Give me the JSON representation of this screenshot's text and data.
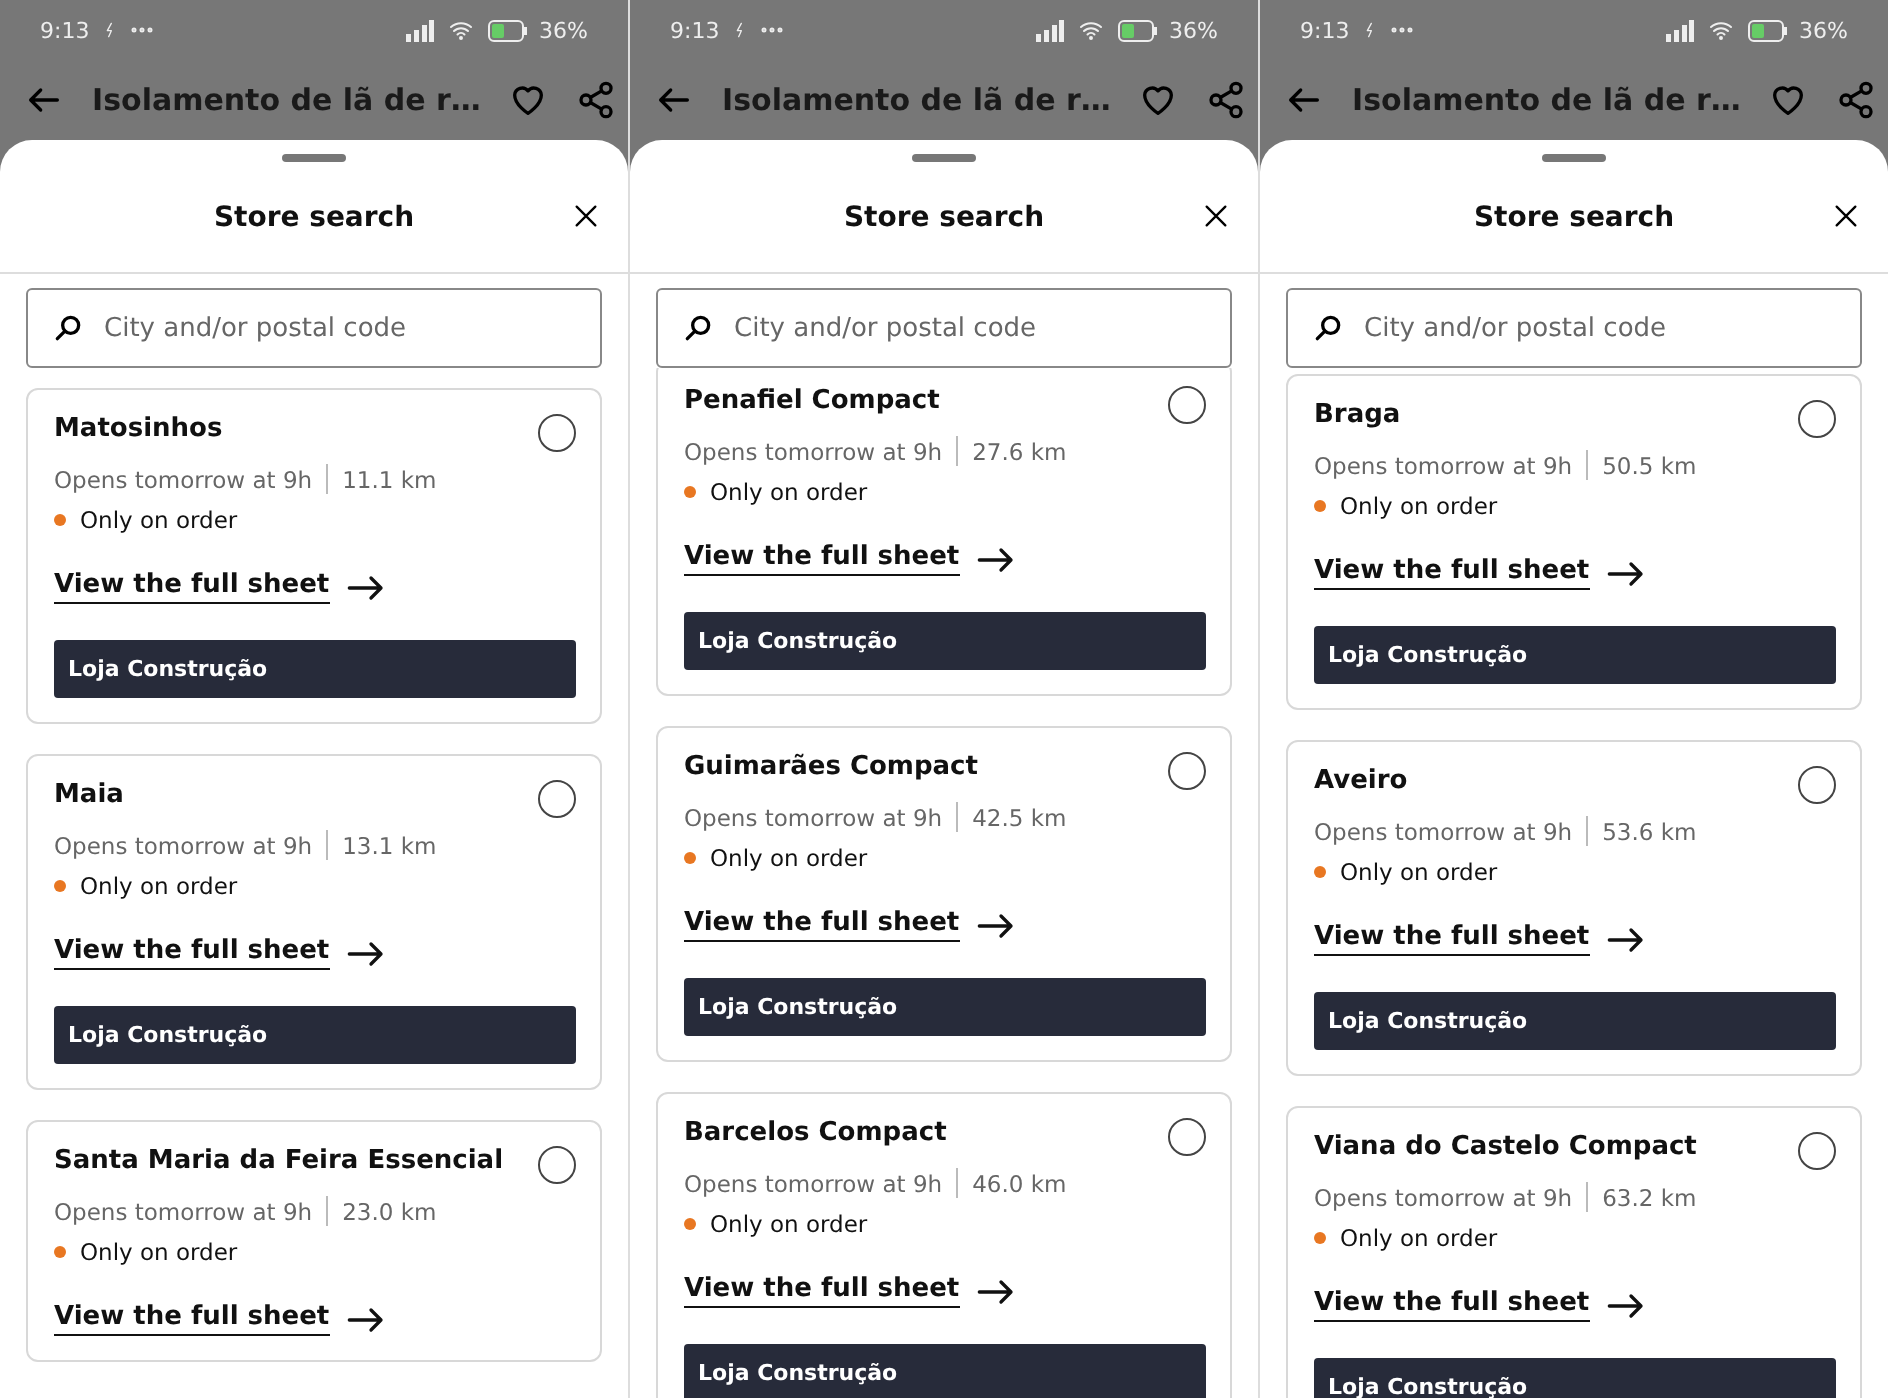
{
  "screens": [
    {
      "status": {
        "time": "9:13",
        "battery": "36%"
      },
      "header": {
        "title": "Isolamento de lã de r…"
      },
      "sheet": {
        "title": "Store search",
        "search": {
          "placeholder": "City and/or postal code"
        }
      },
      "stores": [
        {
          "name": "Matosinhos",
          "opens": "Opens tomorrow at 9h",
          "distance": "11.1 km",
          "availability": "Only on order",
          "link": "View the full sheet",
          "button": "Loja Construção",
          "selected": false
        },
        {
          "name": "Maia",
          "opens": "Opens tomorrow at 9h",
          "distance": "13.1 km",
          "availability": "Only on order",
          "link": "View the full sheet",
          "button": "Loja Construção",
          "selected": false
        },
        {
          "name": "Santa Maria da Feira Essencial",
          "opens": "Opens tomorrow at 9h",
          "distance": "23.0 km",
          "availability": "Only on order",
          "link": "View the full sheet",
          "selected": false
        }
      ]
    },
    {
      "status": {
        "time": "9:13",
        "battery": "36%"
      },
      "header": {
        "title": "Isolamento de lã de r…"
      },
      "sheet": {
        "title": "Store search",
        "search": {
          "placeholder": "City and/or postal code"
        }
      },
      "stores": [
        {
          "name": "Penafiel Compact",
          "opens": "Opens tomorrow at 9h",
          "distance": "27.6 km",
          "availability": "Only on order",
          "link": "View the full sheet",
          "button": "Loja Construção",
          "selected": false
        },
        {
          "name": "Guimarães Compact",
          "opens": "Opens tomorrow at 9h",
          "distance": "42.5 km",
          "availability": "Only on order",
          "link": "View the full sheet",
          "button": "Loja Construção",
          "selected": false
        },
        {
          "name": "Barcelos Compact",
          "opens": "Opens tomorrow at 9h",
          "distance": "46.0 km",
          "availability": "Only on order",
          "link": "View the full sheet",
          "button": "Loja Construção",
          "selected": false
        }
      ]
    },
    {
      "status": {
        "time": "9:13",
        "battery": "36%"
      },
      "header": {
        "title": "Isolamento de lã de r…"
      },
      "sheet": {
        "title": "Store search",
        "search": {
          "placeholder": "City and/or postal code"
        }
      },
      "stores": [
        {
          "name": "Braga",
          "opens": "Opens tomorrow at 9h",
          "distance": "50.5 km",
          "availability": "Only on order",
          "link": "View the full sheet",
          "button": "Loja Construção",
          "selected": false
        },
        {
          "name": "Aveiro",
          "opens": "Opens tomorrow at 9h",
          "distance": "53.6 km",
          "availability": "Only on order",
          "link": "View the full sheet",
          "button": "Loja Construção",
          "selected": false
        },
        {
          "name": "Viana do Castelo Compact",
          "opens": "Opens tomorrow at 9h",
          "distance": "63.2 km",
          "availability": "Only on order",
          "link": "View the full sheet",
          "button": "Loja Construção",
          "selected": false
        }
      ]
    }
  ]
}
